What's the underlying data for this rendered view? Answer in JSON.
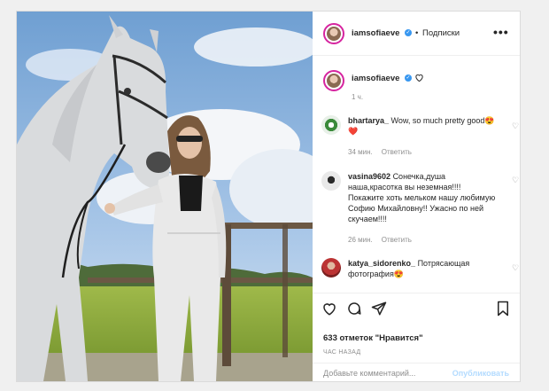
{
  "post": {
    "username": "iamsofiaeve",
    "separator": "•",
    "follow_label": "Подписки",
    "more_label": "•••",
    "caption_time": "1 ч."
  },
  "comments": [
    {
      "author": "bhartarya_",
      "text": "Wow, so much pretty good😍❤️",
      "time": "34 мин.",
      "reply": "Ответить"
    },
    {
      "author": "vasina9602",
      "text": "Сонечка,душа наша,красотка вы неземная!!!! Покажите хоть мельком нашу любимую Софию Михайловну!! Ужасно по ней скучаем!!!!",
      "time": "26 мин.",
      "reply": "Ответить"
    },
    {
      "author": "katya_sidorenko_",
      "text": "Потрясающая фотография😍",
      "time": "",
      "reply": ""
    }
  ],
  "actions": {
    "likes_text": "633 отметок \"Нравится\"",
    "posted": "ЧАС НАЗАД",
    "add_comment_placeholder": "Добавьте комментарий...",
    "publish_label": "Опубликовать"
  },
  "colors": {
    "verified": "#3897f0",
    "story_ring": "#d6249f",
    "publish": "#b3dbff",
    "meta": "#8e8e8e"
  },
  "icons": [
    "verified-badge-icon",
    "more-icon",
    "heart-icon",
    "comment-icon",
    "share-icon",
    "bookmark-icon"
  ]
}
